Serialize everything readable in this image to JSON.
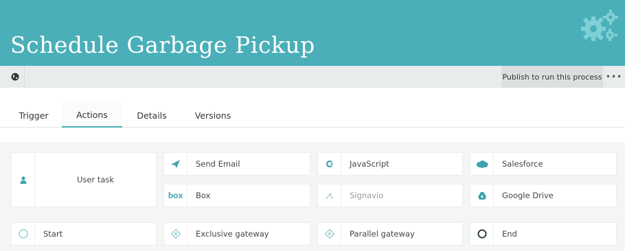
{
  "header": {
    "title": "Schedule Garbage Pickup",
    "icon": "gears-icon",
    "background_color": "#4aafb8"
  },
  "toolbar": {
    "globe_icon": "globe-icon",
    "publish_label": "Publish to run this process",
    "more_label": "•••"
  },
  "tabs": [
    {
      "label": "Trigger",
      "active": false
    },
    {
      "label": "Actions",
      "active": true
    },
    {
      "label": "Details",
      "active": false
    },
    {
      "label": "Versions",
      "active": false
    }
  ],
  "palette": {
    "user_task": {
      "label": "User task",
      "icon": "person-icon"
    },
    "items": [
      {
        "label": "Send Email",
        "icon": "paper-plane-icon"
      },
      {
        "label": "JavaScript",
        "icon": "javascript-icon"
      },
      {
        "label": "Salesforce",
        "icon": "salesforce-cloud-icon"
      },
      {
        "label": "Box",
        "icon": "box-logo-icon",
        "icon_text": "box"
      },
      {
        "label": "Signavio",
        "icon": "signavio-icon",
        "muted": true
      },
      {
        "label": "Google Drive",
        "icon": "google-drive-icon"
      },
      {
        "label": "Start",
        "icon": "start-event-icon"
      },
      {
        "label": "Exclusive gateway",
        "icon": "exclusive-gateway-icon"
      },
      {
        "label": "Parallel gateway",
        "icon": "parallel-gateway-icon"
      },
      {
        "label": "End",
        "icon": "end-event-icon"
      }
    ]
  },
  "colors": {
    "accent": "#4aafb8",
    "icon_teal": "#3ea3ad"
  }
}
